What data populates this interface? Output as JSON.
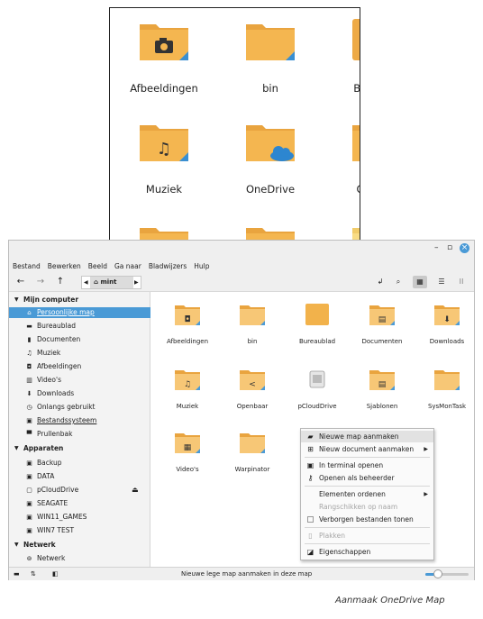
{
  "zoom_inset": {
    "items": [
      {
        "label": "Afbeeldingen",
        "icon": "camera-icon"
      },
      {
        "label": "bin",
        "icon": "folder-icon"
      },
      {
        "label": "Bureaubl",
        "icon": "desktop-folder-icon"
      },
      {
        "label": "Muziek",
        "icon": "music-icon"
      },
      {
        "label": "OneDrive",
        "icon": "cloud-icon"
      },
      {
        "label": "Openba",
        "icon": "share-icon"
      }
    ]
  },
  "window": {
    "controls": {
      "minimize": "–",
      "maximize": "▫",
      "close": "×"
    },
    "menu": [
      "Bestand",
      "Bewerken",
      "Beeld",
      "Ga naar",
      "Bladwijzers",
      "Hulp"
    ],
    "toolbar": {
      "back": "←",
      "forward": "→",
      "up": "↑",
      "location": "mint"
    },
    "sidebar": {
      "sections": [
        {
          "title": "Mijn computer",
          "items": [
            "Persoonlijke map",
            "Bureaublad",
            "Documenten",
            "Muziek",
            "Afbeeldingen",
            "Video's",
            "Downloads",
            "Onlangs gebruikt",
            "Bestandssysteem",
            "Prullenbak"
          ]
        },
        {
          "title": "Apparaten",
          "items": [
            "Backup",
            "DATA",
            "pCloudDrive",
            "SEAGATE",
            "WIN11_GAMES",
            "WIN7 TEST"
          ]
        },
        {
          "title": "Netwerk",
          "items": [
            "Netwerk"
          ]
        }
      ]
    },
    "files": [
      {
        "label": "Afbeeldingen",
        "glyph": "◘"
      },
      {
        "label": "bin",
        "glyph": ""
      },
      {
        "label": "Bureaublad",
        "glyph": ""
      },
      {
        "label": "Documenten",
        "glyph": "▤"
      },
      {
        "label": "Downloads",
        "glyph": "⬇"
      },
      {
        "label": "Muziek",
        "glyph": "♫"
      },
      {
        "label": "Openbaar",
        "glyph": "<"
      },
      {
        "label": "pCloudDrive",
        "glyph": "▣"
      },
      {
        "label": "Sjablonen",
        "glyph": "▤"
      },
      {
        "label": "SysMonTask",
        "glyph": ""
      },
      {
        "label": "Video's",
        "glyph": "▦"
      },
      {
        "label": "Warpinator",
        "glyph": ""
      }
    ],
    "context_menu": [
      {
        "label": "Nieuwe map aanmaken",
        "icon": "new-folder-icon",
        "enabled": true,
        "submenu": false
      },
      {
        "label": "Nieuw document aanmaken",
        "icon": "new-document-icon",
        "enabled": true,
        "submenu": true
      },
      {
        "label": "In terminal openen",
        "icon": "terminal-icon",
        "enabled": true,
        "submenu": false
      },
      {
        "label": "Openen als beheerder",
        "icon": "key-icon",
        "enabled": true,
        "submenu": false
      },
      {
        "label": "Elementen ordenen",
        "icon": "",
        "enabled": true,
        "submenu": true
      },
      {
        "label": "Rangschikken op naam",
        "icon": "",
        "enabled": false,
        "submenu": false
      },
      {
        "label": "Verborgen bestanden tonen",
        "icon": "checkbox-icon",
        "enabled": true,
        "submenu": false
      },
      {
        "label": "Plakken",
        "icon": "paste-icon",
        "enabled": false,
        "submenu": false
      },
      {
        "label": "Eigenschappen",
        "icon": "properties-icon",
        "enabled": true,
        "submenu": false
      }
    ],
    "status": "Nieuwe lege map aanmaken in deze map",
    "zoom_level": 0.3
  },
  "caption": "Aanmaak OneDrive Map",
  "colors": {
    "folder": "#f2b24b",
    "folder_light": "#f7c776",
    "accent": "#4a9ad6",
    "selection": "#4a9ad6"
  }
}
